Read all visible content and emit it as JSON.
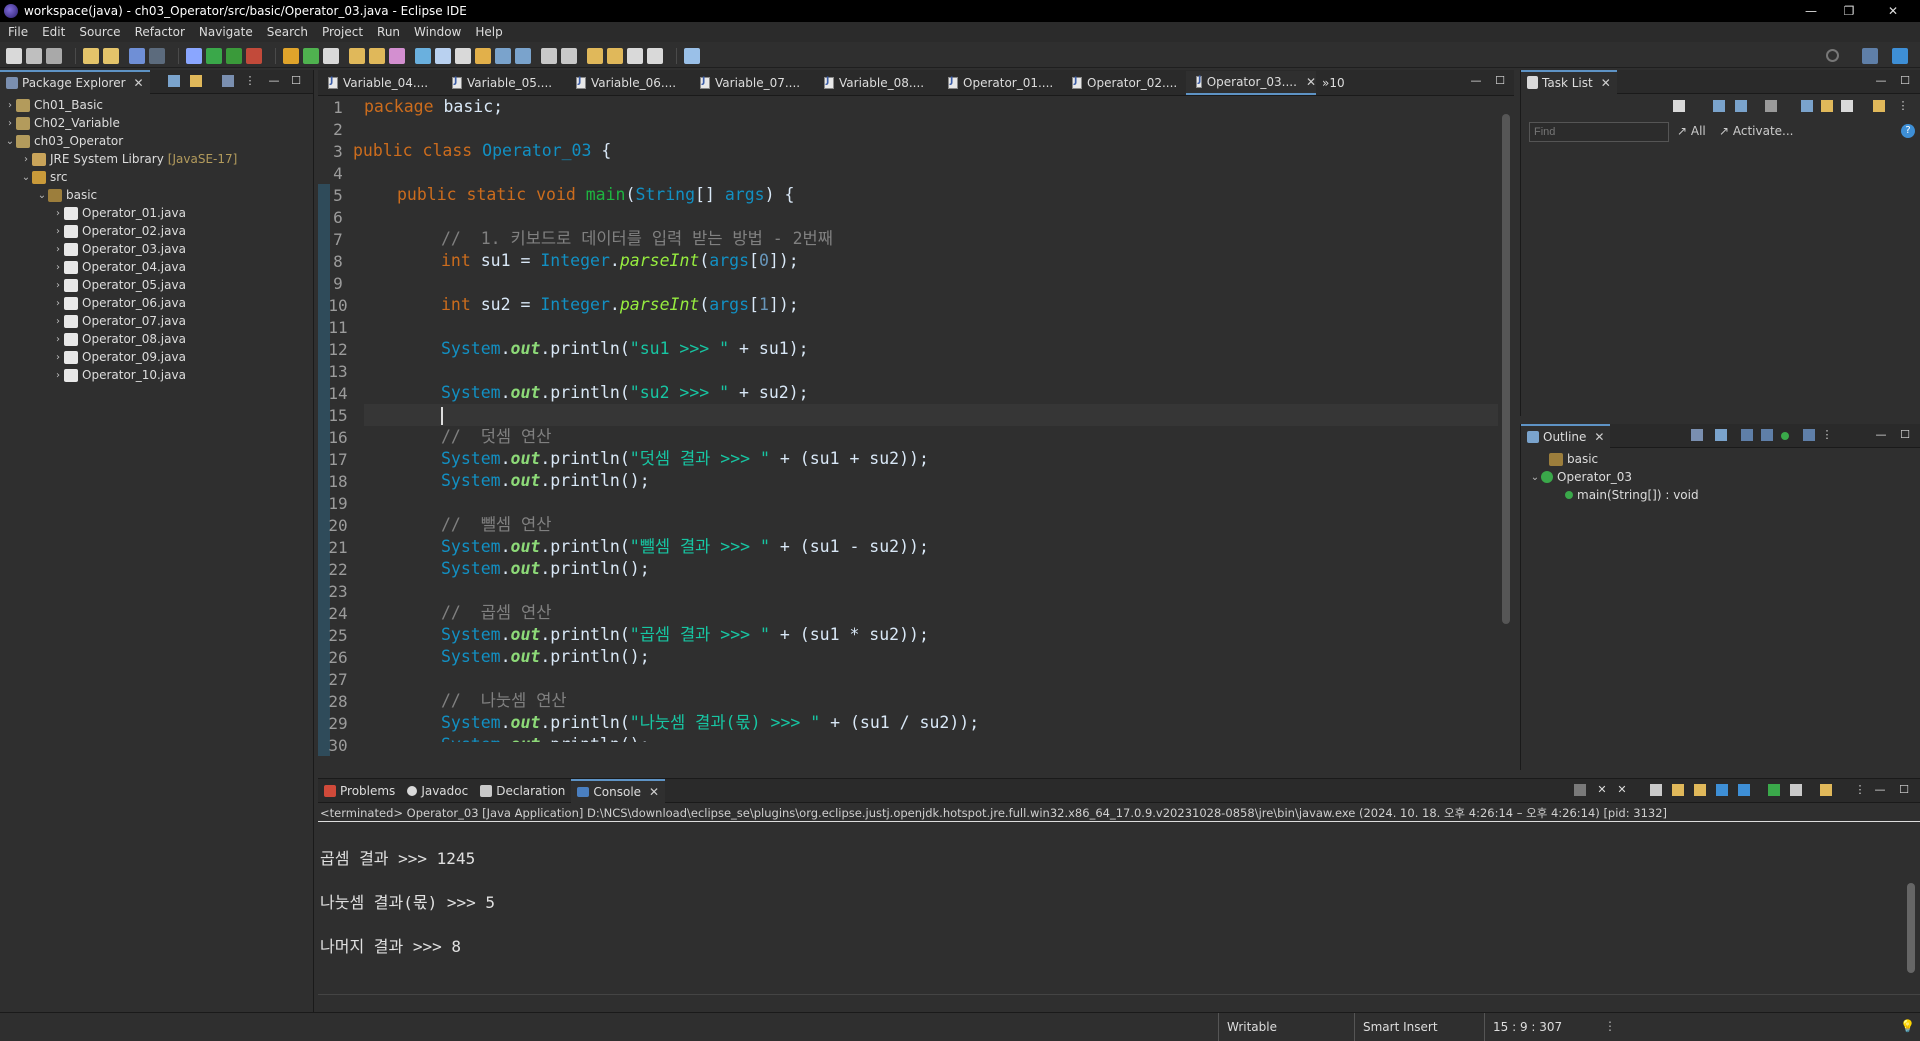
{
  "window": {
    "title": "workspace(java) - ch03_Operator/src/basic/Operator_03.java - Eclipse IDE",
    "minimize": "—",
    "restore": "❐",
    "close": "✕"
  },
  "menu": [
    "File",
    "Edit",
    "Source",
    "Refactor",
    "Navigate",
    "Search",
    "Project",
    "Run",
    "Window",
    "Help"
  ],
  "package_explorer": {
    "title": "Package Explorer",
    "tree": [
      {
        "label": "Ch01_Basic",
        "level": 0,
        "chev": "›",
        "icon": "project-icon"
      },
      {
        "label": "Ch02_Variable",
        "level": 0,
        "chev": "›",
        "icon": "project-icon"
      },
      {
        "label": "ch03_Operator",
        "level": 0,
        "chev": "⌄",
        "icon": "project-icon"
      },
      {
        "label": "JRE System Library",
        "extra": "[JavaSE-17]",
        "level": 1,
        "chev": "›",
        "icon": "library-icon"
      },
      {
        "label": "src",
        "level": 1,
        "chev": "⌄",
        "icon": "source-folder-icon"
      },
      {
        "label": "basic",
        "level": 2,
        "chev": "⌄",
        "icon": "package-icon"
      },
      {
        "label": "Operator_01.java",
        "level": 3,
        "chev": "›",
        "icon": "java-file-icon"
      },
      {
        "label": "Operator_02.java",
        "level": 3,
        "chev": "›",
        "icon": "java-file-icon"
      },
      {
        "label": "Operator_03.java",
        "level": 3,
        "chev": "›",
        "icon": "java-file-icon"
      },
      {
        "label": "Operator_04.java",
        "level": 3,
        "chev": "›",
        "icon": "java-file-icon"
      },
      {
        "label": "Operator_05.java",
        "level": 3,
        "chev": "›",
        "icon": "java-file-icon"
      },
      {
        "label": "Operator_06.java",
        "level": 3,
        "chev": "›",
        "icon": "java-file-icon"
      },
      {
        "label": "Operator_07.java",
        "level": 3,
        "chev": "›",
        "icon": "java-file-icon"
      },
      {
        "label": "Operator_08.java",
        "level": 3,
        "chev": "›",
        "icon": "java-file-icon"
      },
      {
        "label": "Operator_09.java",
        "level": 3,
        "chev": "›",
        "icon": "java-file-icon"
      },
      {
        "label": "Operator_10.java",
        "level": 3,
        "chev": "›",
        "icon": "java-file-icon"
      }
    ]
  },
  "editor": {
    "tabs": [
      "Variable_04....",
      "Variable_05....",
      "Variable_06....",
      "Variable_07....",
      "Variable_08....",
      "Operator_01....",
      "Operator_02....",
      "Operator_03...."
    ],
    "active_tab": 7,
    "overflow": "»10",
    "line_numbers": [
      "1",
      "2",
      "3",
      "4",
      "5",
      "6",
      "7",
      "8",
      "9",
      "10",
      "11",
      "12",
      "13",
      "14",
      "15",
      "16",
      "17",
      "18",
      "19",
      "20",
      "21",
      "22",
      "23",
      "24",
      "25",
      "26",
      "27",
      "28",
      "29",
      "30"
    ],
    "code": {
      "l1_kw": "package",
      "l1_rest": " basic;",
      "l3_kw": "public class",
      "l3_cls": "Operator_03",
      "l3_rest": " {",
      "l5_kw": "public static void",
      "l5_mn": "main",
      "l5_p1": "(",
      "l5_ty": "String",
      "l5_p2": "[] ",
      "l5_ar": "args",
      "l5_p3": ") {",
      "l7_cm": "//  1. 키보드로 데이터를 입력 받는 방법 - 2번째",
      "l8_kw": "int",
      "l8_v": " su1 = ",
      "l8_ty": "Integer",
      "l8_dot": ".",
      "l8_sm": "parseInt",
      "l8_p": "(",
      "l8_ar": "args",
      "l8_b": "[",
      "l8_n": "0",
      "l8_e": "]);",
      "l10_kw": "int",
      "l10_v": " su2 = ",
      "l10_ty": "Integer",
      "l10_dot": ".",
      "l10_sm": "parseInt",
      "l10_p": "(",
      "l10_ar": "args",
      "l10_b": "[",
      "l10_n": "1",
      "l10_e": "]);",
      "sys": "System",
      "dot": ".",
      "out": "out",
      "println": ".println(",
      "l12_str": "\"su1 >>> \"",
      "l12_rest": " + su1);",
      "l14_str": "\"su2 >>> \"",
      "l14_rest": " + su2);",
      "l16_cm": "//  덧셈 연산",
      "l17_str": "\"덧셈 결과 >>> \"",
      "l17_rest": " + (su1 + su2));",
      "empty_println": ".println();",
      "l20_cm": "//  뺄셈 연산",
      "l21_str": "\"뺄셈 결과 >>> \"",
      "l21_rest": " + (su1 - su2));",
      "l24_cm": "//  곱셈 연산",
      "l25_str": "\"곱셈 결과 >>> \"",
      "l25_rest": " + (su1 * su2));",
      "l28_cm": "//  나눗셈 연산",
      "l29_str": "\"나눗셈 결과(몫) >>> \"",
      "l29_rest": " + (su1 / su2));"
    }
  },
  "task_list": {
    "title": "Task List",
    "find_placeholder": "Find",
    "all": "All",
    "activate": "Activate..."
  },
  "outline": {
    "title": "Outline",
    "items": [
      "basic",
      "Operator_03",
      "main(String[]) : void"
    ]
  },
  "bottom": {
    "tabs": [
      "Problems",
      "Javadoc",
      "Declaration",
      "Console"
    ],
    "terminated": "<terminated> Operator_03 [Java Application] D:\\NCS\\download\\eclipse_se\\plugins\\org.eclipse.justj.openjdk.hotspot.jre.full.win32.x86_64_17.0.9.v20231028-0858\\jre\\bin\\javaw.exe  (2024. 10. 18. 오후 4:26:14 – 오후 4:26:14) [pid: 3132]",
    "output": [
      "곱셈 결과 >>> 1245",
      "나눗셈 결과(몫) >>> 5",
      "나머지 결과 >>> 8"
    ]
  },
  "status": {
    "writable": "Writable",
    "insert": "Smart Insert",
    "position": "15 : 9 : 307"
  },
  "colors": {
    "background": "#2f2f2f",
    "keyword": "#cc6c1d",
    "string": "#17c6a3",
    "comment": "#808080",
    "accent": "#5e93c5"
  }
}
